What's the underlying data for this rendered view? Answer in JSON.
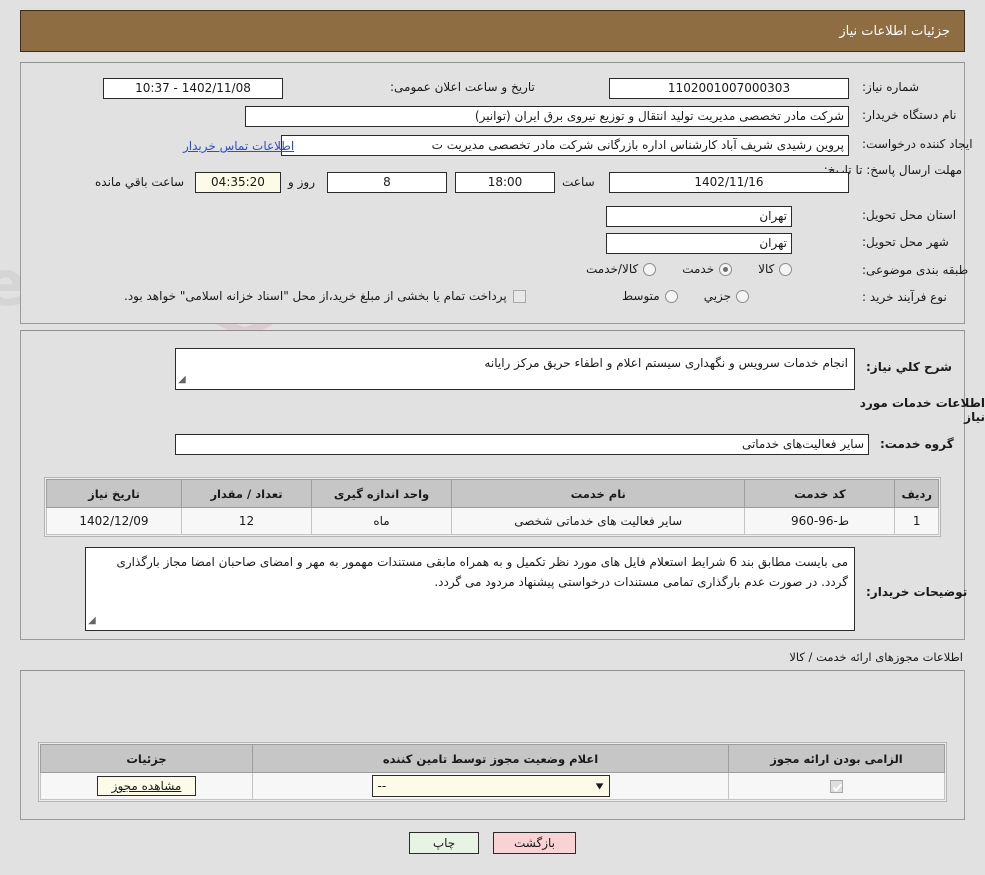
{
  "header": {
    "title": "جزئیات اطلاعات نیاز"
  },
  "top_form": {
    "need_number_label": "شماره نیاز:",
    "need_number_value": "1102001007000303",
    "announce_datetime_label": "تاریخ و ساعت اعلان عمومی:",
    "announce_datetime_value": "1402/11/08 - 10:37",
    "buyer_org_label": "نام دستگاه خریدار:",
    "buyer_org_value": "شرکت مادر تخصصی مدیریت تولید  انتقال و توزیع نیروی برق ایران (توانیر)",
    "creator_label": "ایجاد کننده درخواست:",
    "creator_value": "پروین رشیدی شریف آباد کارشناس اداره بازرگانی شرکت مادر تخصصی مدیریت ت",
    "buyer_contact_link": "اطلاعات تماس خریدار",
    "deadline_label": "مهلت ارسال پاسخ: تا تاریخ:",
    "deadline_date": "1402/11/16",
    "deadline_hour_label": "ساعت",
    "deadline_hour": "18:00",
    "remaining_days": "8",
    "remaining_days_suffix": "روز و",
    "remaining_time": "04:35:20",
    "remaining_time_suffix": "ساعت باقي مانده",
    "province_label": "استان محل تحویل:",
    "province_value": "تهران",
    "city_label": "شهر محل تحویل:",
    "city_value": "تهران",
    "category_label": "طبقه بندی موضوعی:",
    "category_options": [
      "کالا",
      "خدمت",
      "کالا/خدمت"
    ],
    "category_selected": "خدمت",
    "process_label": "نوع فرآیند خرید :",
    "process_options": [
      "جزیي",
      "متوسط"
    ],
    "process_selected": "",
    "treasury_checkbox_label": "پرداخت تمام یا بخشی از مبلغ خرید،از محل \"اسناد خزانه اسلامی\" خواهد بود.",
    "treasury_checked": false
  },
  "mid": {
    "general_desc_label": "شرح كلي نیاز:",
    "general_desc_value": "انجام خدمات سرویس و نگهداری سیستم اعلام و اطفاء حریق مرکز رایانه",
    "services_heading": "اطلاعات خدمات مورد نیاز",
    "service_group_label": "گروه خدمت:",
    "service_group_value": "سایر فعالیت‌های خدماتی",
    "table": {
      "columns": [
        "ردیف",
        "کد خدمت",
        "نام خدمت",
        "واحد اندازه گیری",
        "تعداد / مقدار",
        "تاریخ نیاز"
      ],
      "rows": [
        {
          "row_no": "1",
          "service_code": "ط-96-960",
          "service_name": "سایر فعالیت های خدماتی شخصی",
          "unit": "ماه",
          "quantity": "12",
          "need_date": "1402/12/09"
        }
      ]
    },
    "buyer_notes_label": "توضیحات خریدار:",
    "buyer_notes_value": "می بایست مطابق بند 6 شرایط استعلام فایل های مورد نظر تکمیل و به همراه مابقی مستندات مهمور به مهر و امضای صاحبان امضا مجاز بارگذاری گردد. در صورت عدم بارگذاری تمامی مستندات درخواستی پیشنهاد مردود می گردد."
  },
  "permits": {
    "caption": "اطلاعات مجوزهای ارائه خدمت / کالا",
    "columns": [
      "الزامی بودن ارائه مجوز",
      "اعلام وضعیت مجوز توسط تامین کننده",
      "جزئیات"
    ],
    "rows": [
      {
        "required_checked": true,
        "status_value": "--",
        "detail_link": "مشاهده مجوز"
      }
    ]
  },
  "footer": {
    "print_label": "چاپ",
    "back_label": "بازگشت"
  },
  "colors": {
    "header_bg": "#8d6d41",
    "page_bg": "#e1e1e1",
    "link": "#2a4fd6",
    "print_btn": "#e7f4e4",
    "back_btn": "#f9d3d3",
    "highlight_field": "#fbfbe8"
  },
  "watermark": {
    "text": "AriaTender.net"
  }
}
